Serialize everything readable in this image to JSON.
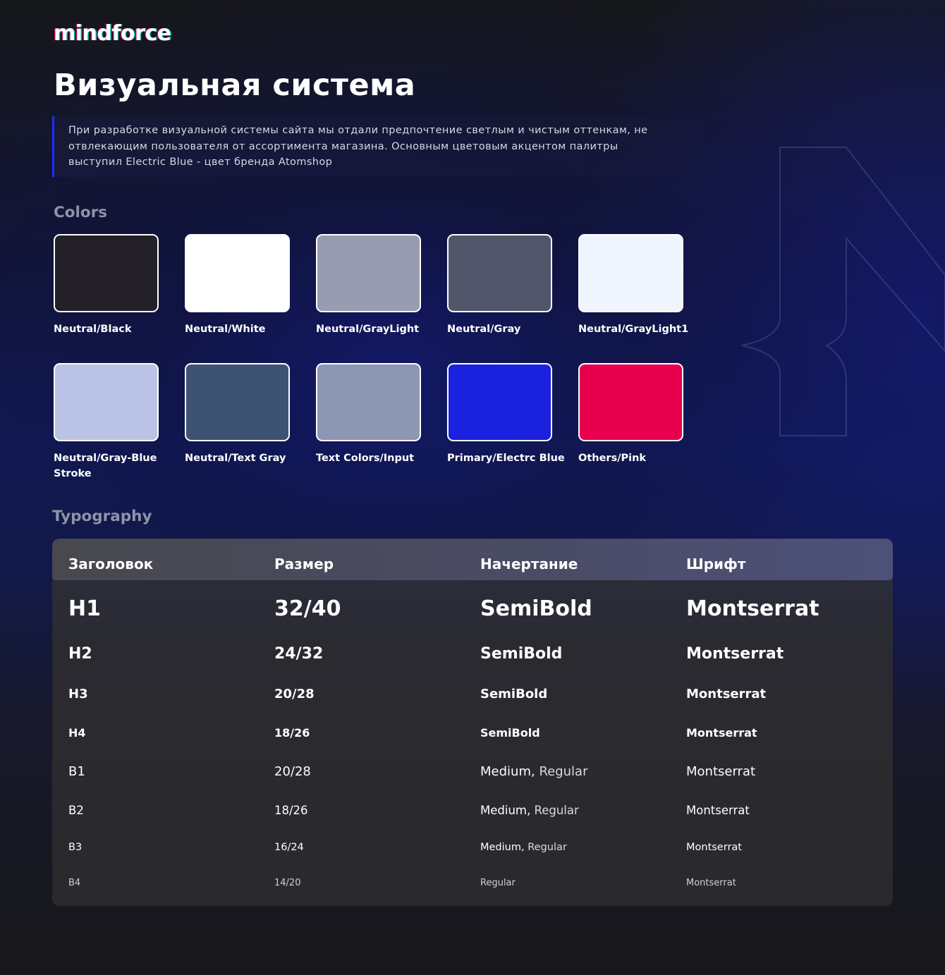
{
  "brand": {
    "logo_text": "mindforce"
  },
  "page": {
    "title": "Визуальная система",
    "intro_lines": [
      "При разработке визуальной системы сайта мы отдали предпочтение светлым и чистым оттенкам, не",
      "отвлекающим пользователя от ассортимента магазина. Основным цветовым акцентом палитры",
      "выступил Electric Blue - цвет бренда Atomshop"
    ]
  },
  "colors": {
    "title": "Colors",
    "swatches": [
      {
        "label": "Neutral/Black",
        "color": "#232127"
      },
      {
        "label": "Neutral/White",
        "color": "#ffffff"
      },
      {
        "label": "Neutral/GrayLight",
        "color": "#989cb0"
      },
      {
        "label": "Neutral/Gray",
        "color": "#51566a"
      },
      {
        "label": "Neutral/GrayLight1",
        "color": "#f0f4fc"
      },
      {
        "label": "Neutral/Gray-Blue Stroke",
        "color": "#bac3e6"
      },
      {
        "label": "Neutral/Text Gray",
        "color": "#3e5373"
      },
      {
        "label": "Text Colors/Input",
        "color": "#8d96b3"
      },
      {
        "label": "Primary/Electrc Blue",
        "color": "#1a22e0"
      },
      {
        "label": "Others/Pink",
        "color": "#e8004f"
      }
    ]
  },
  "typography": {
    "title": "Typography",
    "headers": [
      "Заголовок",
      "Размер",
      "Начертание",
      "Шрифт"
    ],
    "rows": [
      {
        "name": "H1",
        "size": "32/40",
        "weight": "SemiBold",
        "weight_extra": "",
        "font": "Montserrat"
      },
      {
        "name": "H2",
        "size": "24/32",
        "weight": "SemiBold",
        "weight_extra": "",
        "font": "Montserrat"
      },
      {
        "name": "H3",
        "size": "20/28",
        "weight": "SemiBold",
        "weight_extra": "",
        "font": "Montserrat"
      },
      {
        "name": "H4",
        "size": "18/26",
        "weight": "SemiBold",
        "weight_extra": "",
        "font": "Montserrat"
      },
      {
        "name": "B1",
        "size": "20/28",
        "weight": "Medium,",
        "weight_extra": "Regular",
        "font": "Montserrat"
      },
      {
        "name": "B2",
        "size": "18/26",
        "weight": "Medium,",
        "weight_extra": "Regular",
        "font": "Montserrat"
      },
      {
        "name": "B3",
        "size": "16/24",
        "weight": "Medium,",
        "weight_extra": "Regular",
        "font": "Montserrat"
      },
      {
        "name": "B4",
        "size": "14/20",
        "weight": "Regular",
        "weight_extra": "",
        "font": "Montserrat"
      }
    ]
  }
}
